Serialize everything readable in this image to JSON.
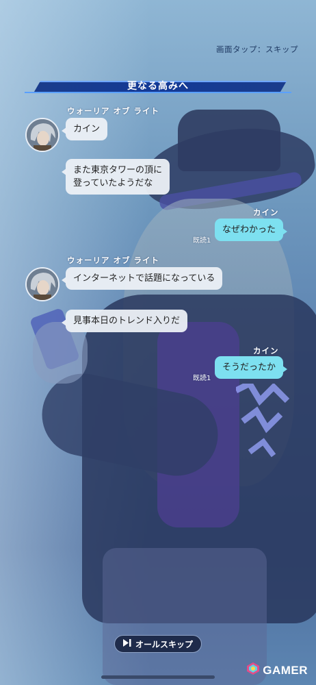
{
  "header": {
    "skip_hint": "画面タップ：スキップ"
  },
  "chapter": {
    "title": "更なる高みへ"
  },
  "messages": [
    {
      "speaker": "ウォーリア オブ ライト",
      "text": "カイン"
    },
    {
      "line1": "また東京タワーの頂に",
      "line2": "登っていたようだな"
    },
    {
      "speaker": "カイン",
      "text": "なぜわかった",
      "read": "既読1"
    },
    {
      "speaker": "ウォーリア オブ ライト",
      "text": "インターネットで話題になっている"
    },
    {
      "text": "見事本日のトレンド入りだ"
    },
    {
      "speaker": "カイン",
      "text": "そうだったか",
      "read": "既読1"
    }
  ],
  "footer": {
    "all_skip_label": "オールスキップ"
  },
  "watermark": {
    "text": "GAMER"
  },
  "colors": {
    "right_bubble": "#7de0f0",
    "left_bubble": "#ecf0f6",
    "title_band": "#143a96"
  }
}
